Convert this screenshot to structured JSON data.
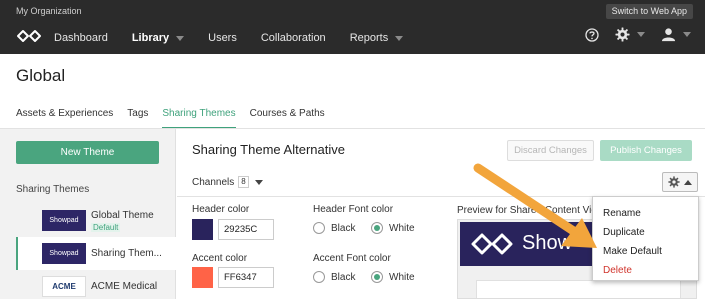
{
  "topbar": {
    "org_name": "My Organization",
    "switch_label": "Switch to Web App",
    "nav": [
      {
        "label": "Dashboard",
        "has_caret": false,
        "active": false
      },
      {
        "label": "Library",
        "has_caret": true,
        "active": true
      },
      {
        "label": "Users",
        "has_caret": false,
        "active": false
      },
      {
        "label": "Collaboration",
        "has_caret": false,
        "active": false
      },
      {
        "label": "Reports",
        "has_caret": true,
        "active": false
      }
    ],
    "icons": [
      "help-icon",
      "gear-icon",
      "user-icon"
    ]
  },
  "page": {
    "title": "Global",
    "tabs": [
      "Assets & Experiences",
      "Tags",
      "Sharing Themes",
      "Courses & Paths"
    ],
    "active_tab": "Sharing Themes"
  },
  "sidebar": {
    "new_button": "New Theme",
    "heading": "Sharing Themes",
    "themes": [
      {
        "thumb": "Showpad",
        "name": "Global Theme",
        "badge": "Default"
      },
      {
        "thumb": "Showpad",
        "name": "Sharing Them..."
      },
      {
        "thumb": "ACME",
        "name": "ACME Medical"
      }
    ]
  },
  "editor": {
    "title": "Sharing Theme Alternative",
    "discard_label": "Discard Changes",
    "publish_label": "Publish Changes",
    "channels_label": "Channels",
    "channels_count": "8",
    "header_color_label": "Header color",
    "header_color_value": "29235C",
    "accent_color_label": "Accent color",
    "accent_color_value": "FF6347",
    "header_font_label": "Header Font color",
    "accent_font_label": "Accent Font color",
    "font_options": [
      "Black",
      "White"
    ],
    "header_font_selected": "White",
    "accent_font_selected": "White",
    "preview_label": "Preview for Shared Content View",
    "preview_brand": "Show"
  },
  "menu": {
    "items": [
      "Rename",
      "Duplicate",
      "Make Default",
      "Delete"
    ]
  },
  "colors": {
    "header_swatch": "#29235C",
    "accent_swatch": "#FF6347",
    "brand_green": "#4aa57f",
    "arrow": "#f2a53c"
  }
}
